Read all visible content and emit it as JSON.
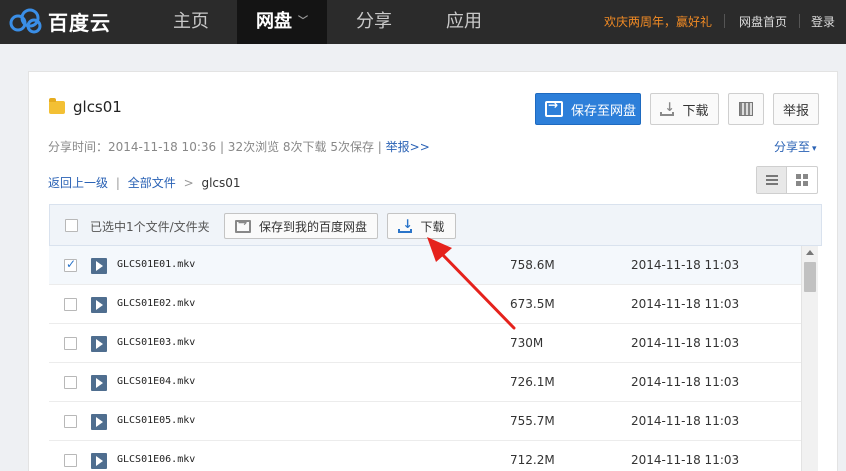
{
  "header": {
    "logo_text": "百度云",
    "nav": [
      {
        "label": "主页",
        "active": false
      },
      {
        "label": "网盘",
        "active": true
      },
      {
        "label": "分享",
        "active": false
      },
      {
        "label": "应用",
        "active": false
      }
    ],
    "promo": "欢庆两周年，赢好礼",
    "links": [
      "网盘首页",
      "登录"
    ]
  },
  "share": {
    "folder_name": "glcs01",
    "meta_text": "分享时间：2014-11-18 10:36 | 32次浏览 8次下载 5次保存 | ",
    "report_link": "举报>>",
    "share_to": "分享至",
    "buttons": {
      "save": "保存至网盘",
      "download": "下载",
      "report": "举报"
    }
  },
  "breadcrumb": {
    "back": "返回上一级",
    "all_files": "全部文件",
    "current": "glcs01",
    "separator": "|",
    "arrow": ">"
  },
  "list": {
    "selected_text": "已选中1个文件/文件夹",
    "save_button": "保存到我的百度网盘",
    "download_button": "下载",
    "rows": [
      {
        "name": "GLCS01E01.mkv",
        "size": "758.6M",
        "date": "2014-11-18 11:03",
        "checked": true
      },
      {
        "name": "GLCS01E02.mkv",
        "size": "673.5M",
        "date": "2014-11-18 11:03",
        "checked": false
      },
      {
        "name": "GLCS01E03.mkv",
        "size": "730M",
        "date": "2014-11-18 11:03",
        "checked": false
      },
      {
        "name": "GLCS01E04.mkv",
        "size": "726.1M",
        "date": "2014-11-18 11:03",
        "checked": false
      },
      {
        "name": "GLCS01E05.mkv",
        "size": "755.7M",
        "date": "2014-11-18 11:03",
        "checked": false
      },
      {
        "name": "GLCS01E06.mkv",
        "size": "712.2M",
        "date": "2014-11-18 11:03",
        "checked": false
      }
    ]
  },
  "colors": {
    "topbar": "#2b2b2b",
    "primary": "#2d7fd9",
    "promo": "#f08a24",
    "link": "#2a62b5",
    "annotation_arrow": "#e5221c"
  }
}
